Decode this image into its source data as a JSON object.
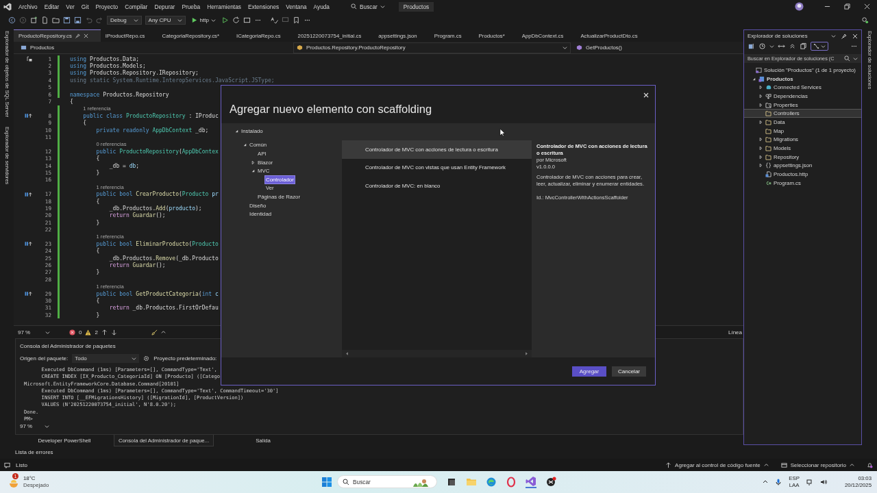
{
  "menu": [
    "Archivo",
    "Editar",
    "Ver",
    "Git",
    "Proyecto",
    "Compilar",
    "Depurar",
    "Prueba",
    "Herramientas",
    "Extensiones",
    "Ventana",
    "Ayuda"
  ],
  "search_menu": "Buscar",
  "solution_name": "Productos",
  "toolbar": {
    "configuration": "Debug",
    "platform": "Any CPU",
    "run_target": "http"
  },
  "left_rail": [
    "Explorador de objetos de SQL Server",
    "Explorador de servidores"
  ],
  "right_rail": [
    "Explorador de soluciones"
  ],
  "tabs": [
    {
      "label": "ProductoRepository.cs",
      "selected": true
    },
    {
      "label": "IProductRepo.cs",
      "selected": false
    },
    {
      "label": "CategoriaRepository.cs*",
      "selected": false
    },
    {
      "label": "ICategoriaRepo.cs",
      "selected": false
    },
    {
      "label": "20251220073754_initial.cs",
      "selected": false
    },
    {
      "label": "appsettings.json",
      "selected": false
    },
    {
      "label": "Program.cs",
      "selected": false
    },
    {
      "label": "Productos*",
      "selected": false
    },
    {
      "label": "AppDbContext.cs",
      "selected": false
    },
    {
      "label": "ActualizarProductDto.cs",
      "selected": false
    }
  ],
  "navbar": {
    "project": "Productos",
    "type": "Productos.Repository.ProductoRepository",
    "member": "GetProductos()"
  },
  "code_lines": [
    {
      "kind": "code",
      "number": "1",
      "changed": true,
      "tokens": [
        {
          "kind": "kw",
          "t": "using"
        },
        {
          "kind": "plain",
          "t": " Productos.Data;"
        }
      ]
    },
    {
      "kind": "code",
      "number": "2",
      "changed": true,
      "tokens": [
        {
          "kind": "kw",
          "t": "using"
        },
        {
          "kind": "plain",
          "t": " Productos.Models;"
        }
      ]
    },
    {
      "kind": "code",
      "number": "3",
      "changed": true,
      "tokens": [
        {
          "kind": "kw",
          "t": "using"
        },
        {
          "kind": "plain",
          "t": " Productos.Repository.IRepository;"
        }
      ]
    },
    {
      "kind": "code",
      "number": "4",
      "changed": true,
      "tokens": [
        {
          "kind": "dim",
          "t": "using static System.Runtime.InteropServices.JavaScript.JSType;"
        }
      ]
    },
    {
      "kind": "code",
      "number": "5",
      "changed": true
    },
    {
      "kind": "code",
      "number": "6",
      "changed": true,
      "tokens": [
        {
          "kind": "kw",
          "t": "namespace"
        },
        {
          "kind": "plain",
          "t": " Productos.Repository"
        }
      ]
    },
    {
      "kind": "code",
      "number": "7",
      "changed": false,
      "tokens": [
        {
          "kind": "plain",
          "t": "{"
        }
      ]
    },
    {
      "kind": "lens",
      "changed": true,
      "text": "1 referencia"
    },
    {
      "kind": "code",
      "number": "8",
      "changed": true,
      "tokens": [
        {
          "kind": "kw",
          "t": "    public class"
        },
        {
          "kind": "type",
          "t": " ProductoRepository"
        },
        {
          "kind": "plain",
          "t": " : IProduc"
        }
      ]
    },
    {
      "kind": "code",
      "number": "9",
      "changed": true,
      "tokens": [
        {
          "kind": "plain",
          "t": "    {"
        }
      ]
    },
    {
      "kind": "code",
      "number": "10",
      "changed": true,
      "tokens": [
        {
          "kind": "kw",
          "t": "        private readonly"
        },
        {
          "kind": "type",
          "t": " AppDbContext"
        },
        {
          "kind": "plain",
          "t": " _db;"
        }
      ]
    },
    {
      "kind": "code",
      "number": "11",
      "changed": true
    },
    {
      "kind": "lens",
      "changed": true,
      "text": "0 referencias"
    },
    {
      "kind": "code",
      "number": "12",
      "changed": true,
      "tokens": [
        {
          "kind": "kw",
          "t": "        public"
        },
        {
          "kind": "type",
          "t": " ProductoRepository"
        },
        {
          "kind": "plain",
          "t": "("
        },
        {
          "kind": "type",
          "t": "AppDbContex"
        }
      ]
    },
    {
      "kind": "code",
      "number": "13",
      "changed": true,
      "tokens": [
        {
          "kind": "plain",
          "t": "        {"
        }
      ]
    },
    {
      "kind": "code",
      "number": "14",
      "changed": true,
      "tokens": [
        {
          "kind": "plain",
          "t": "            _db = "
        },
        {
          "kind": "param",
          "t": "db"
        },
        {
          "kind": "plain",
          "t": ";"
        }
      ]
    },
    {
      "kind": "code",
      "number": "15",
      "changed": true,
      "tokens": [
        {
          "kind": "plain",
          "t": "        }"
        }
      ]
    },
    {
      "kind": "code",
      "number": "16",
      "changed": true
    },
    {
      "kind": "lens",
      "changed": true,
      "text": "1 referencia"
    },
    {
      "kind": "code",
      "number": "17",
      "changed": true,
      "tokens": [
        {
          "kind": "kw",
          "t": "        public bool"
        },
        {
          "kind": "fn",
          "t": " CrearProducto"
        },
        {
          "kind": "plain",
          "t": "("
        },
        {
          "kind": "type",
          "t": "Producto"
        },
        {
          "kind": "param",
          "t": " pr"
        }
      ]
    },
    {
      "kind": "code",
      "number": "18",
      "changed": true,
      "tokens": [
        {
          "kind": "plain",
          "t": "        {"
        }
      ]
    },
    {
      "kind": "code",
      "number": "19",
      "changed": true,
      "tokens": [
        {
          "kind": "plain",
          "t": "            _db.Productos."
        },
        {
          "kind": "fn",
          "t": "Add"
        },
        {
          "kind": "plain",
          "t": "("
        },
        {
          "kind": "param",
          "t": "producto"
        },
        {
          "kind": "plain",
          "t": ");"
        }
      ]
    },
    {
      "kind": "code",
      "number": "20",
      "changed": true,
      "tokens": [
        {
          "kind": "ctl",
          "t": "            return"
        },
        {
          "kind": "fn",
          "t": " Guardar"
        },
        {
          "kind": "plain",
          "t": "();"
        }
      ]
    },
    {
      "kind": "code",
      "number": "21",
      "changed": true,
      "tokens": [
        {
          "kind": "plain",
          "t": "        }"
        }
      ]
    },
    {
      "kind": "code",
      "number": "22",
      "changed": true
    },
    {
      "kind": "lens",
      "changed": true,
      "text": "1 referencia"
    },
    {
      "kind": "code",
      "number": "23",
      "changed": true,
      "tokens": [
        {
          "kind": "kw",
          "t": "        public bool"
        },
        {
          "kind": "fn",
          "t": " EliminarProducto"
        },
        {
          "kind": "plain",
          "t": "("
        },
        {
          "kind": "type",
          "t": "Producto"
        }
      ]
    },
    {
      "kind": "code",
      "number": "24",
      "changed": true,
      "tokens": [
        {
          "kind": "plain",
          "t": "        {"
        }
      ]
    },
    {
      "kind": "code",
      "number": "25",
      "changed": true,
      "tokens": [
        {
          "kind": "plain",
          "t": "            _db.Productos."
        },
        {
          "kind": "fn",
          "t": "Remove"
        },
        {
          "kind": "plain",
          "t": "(_db.Producto"
        }
      ]
    },
    {
      "kind": "code",
      "number": "26",
      "changed": true,
      "tokens": [
        {
          "kind": "ctl",
          "t": "            return"
        },
        {
          "kind": "fn",
          "t": " Guardar"
        },
        {
          "kind": "plain",
          "t": "();"
        }
      ]
    },
    {
      "kind": "code",
      "number": "27",
      "changed": true,
      "tokens": [
        {
          "kind": "plain",
          "t": "        }"
        }
      ]
    },
    {
      "kind": "code",
      "number": "28",
      "changed": true
    },
    {
      "kind": "lens",
      "changed": true,
      "text": "1 referencia"
    },
    {
      "kind": "code",
      "number": "29",
      "changed": true,
      "tokens": [
        {
          "kind": "kw",
          "t": "        public bool"
        },
        {
          "kind": "fn",
          "t": " GetProductCategoria"
        },
        {
          "kind": "plain",
          "t": "("
        },
        {
          "kind": "kw",
          "t": "int"
        },
        {
          "kind": "param",
          "t": " c"
        }
      ]
    },
    {
      "kind": "code",
      "number": "30",
      "changed": true,
      "tokens": [
        {
          "kind": "plain",
          "t": "        {"
        }
      ]
    },
    {
      "kind": "code",
      "number": "31",
      "changed": true,
      "tokens": [
        {
          "kind": "ctl",
          "t": "            return"
        },
        {
          "kind": "plain",
          "t": " _db.Productos.FirstOrDefau"
        }
      ]
    },
    {
      "kind": "code",
      "number": "32",
      "changed": true,
      "tokens": [
        {
          "kind": "plain",
          "t": "        }"
        }
      ]
    }
  ],
  "editor_status": {
    "zoom": "97 %",
    "errors": "0",
    "warnings": "2",
    "position": "Línea"
  },
  "console": {
    "title": "Consola del Administrador de paquetes",
    "source_label": "Origen del paquete:",
    "source": "Todo",
    "project_label": "Proyecto predeterminado:",
    "output": [
      "      Executed DbCommand (1ms) [Parameters=[], CommandType='Text',",
      "      CREATE INDEX [IX_Producto_CategoriaId] ON [Producto] ([Catego",
      "Microsoft.EntityFrameworkCore.Database.Command[20101]",
      "      Executed DbCommand (1ms) [Parameters=[], CommandType='Text', CommandTimeout='30']",
      "      INSERT INTO [__EFMigrationsHistory] ([MigrationId], [ProductVersion])",
      "      VALUES (N'20251220073754_initial', N'8.0.20');",
      "Done.",
      "PM>"
    ],
    "zoom": "97 %"
  },
  "bottom_tabs": [
    {
      "label": "Developer PowerShell",
      "selected": false
    },
    {
      "label": "Consola del Administrador de paque...",
      "selected": true
    },
    {
      "label": "Salida",
      "selected": false
    }
  ],
  "error_list": "Lista de errores",
  "status_bar": {
    "state": "Listo",
    "source_control": "Agregar al control de código fuente",
    "repository": "Seleccionar repositorio"
  },
  "solution_explorer": {
    "title": "Explorador de soluciones",
    "search": {
      "placeholder": "Buscar en Explorador de soluciones (C"
    },
    "tree": [
      {
        "label": "Solución \"Productos\"  (1 de 1 proyecto)",
        "kind": "solution",
        "selected": false,
        "children": [
          {
            "label": "Productos",
            "kind": "project",
            "selected": false,
            "expanded": true,
            "children": [
              {
                "label": "Connected Services",
                "kind": "service",
                "selected": false,
                "expanded": false
              },
              {
                "label": "Dependencias",
                "kind": "deps",
                "selected": false,
                "expanded": false
              },
              {
                "label": "Properties",
                "kind": "props",
                "selected": false,
                "expanded": false
              },
              {
                "label": "Controllers",
                "kind": "folder",
                "selected": true
              },
              {
                "label": "Data",
                "kind": "folder",
                "selected": false,
                "expanded": false
              },
              {
                "label": "Map",
                "kind": "folder",
                "selected": false
              },
              {
                "label": "Migrations",
                "kind": "folder",
                "selected": false,
                "expanded": false
              },
              {
                "label": "Models",
                "kind": "folder",
                "selected": false,
                "expanded": false
              },
              {
                "label": "Repository",
                "kind": "folder",
                "selected": false,
                "expanded": false
              },
              {
                "label": "appsettings.json",
                "kind": "json",
                "selected": false,
                "expanded": false
              },
              {
                "label": "Productos.http",
                "kind": "http",
                "selected": false
              },
              {
                "label": "Program.cs",
                "kind": "csharp",
                "selected": false
              }
            ]
          }
        ]
      }
    ]
  },
  "dialog": {
    "title": "Agregar nuevo elemento con scaffolding",
    "tree": [
      {
        "label": "Instalado",
        "selected": false,
        "expanded": true,
        "children": [
          {
            "label": "Común",
            "selected": false,
            "expanded": true,
            "children": [
              {
                "label": "API",
                "selected": false
              },
              {
                "label": "Blazor",
                "selected": false,
                "expanded": false
              },
              {
                "label": "MVC",
                "selected": false,
                "expanded": true,
                "children": [
                  {
                    "label": "Controlador",
                    "selected": true
                  },
                  {
                    "label": "Ver",
                    "selected": false
                  }
                ]
              },
              {
                "label": "Páginas de Razor",
                "selected": false
              }
            ]
          },
          {
            "label": "Diseño",
            "selected": false
          },
          {
            "label": "Identidad",
            "selected": false
          }
        ]
      }
    ],
    "templates": [
      {
        "label": "Controlador de MVC con acciones de lectura o escritura",
        "selected": true
      },
      {
        "label": "Controlador de MVC con vistas que usan Entity Framework",
        "selected": false
      },
      {
        "label": "Controlador de MVC: en blanco",
        "selected": false
      }
    ],
    "details": {
      "title": "Controlador de MVC con acciones de lectura o escritura",
      "author": "por Microsoft",
      "version": "v1.0.0.0",
      "description": "Controlador de MVC con acciones para crear, leer, actualizar, eliminar y enumerar entidades.",
      "id": "Id.: MvcControllerWithActionsScaffolder"
    },
    "buttons": [
      {
        "label": "Agregar",
        "kind": "primary"
      },
      {
        "label": "Cancelar",
        "kind": "secondary"
      }
    ]
  },
  "taskbar": {
    "weather_badge": "1",
    "temperature": "18°C",
    "weather": "Despejado",
    "search": {
      "placeholder": "Buscar"
    },
    "language": "ESP",
    "layout": "LAA",
    "time": "03:03",
    "date": "20/12/2025"
  }
}
